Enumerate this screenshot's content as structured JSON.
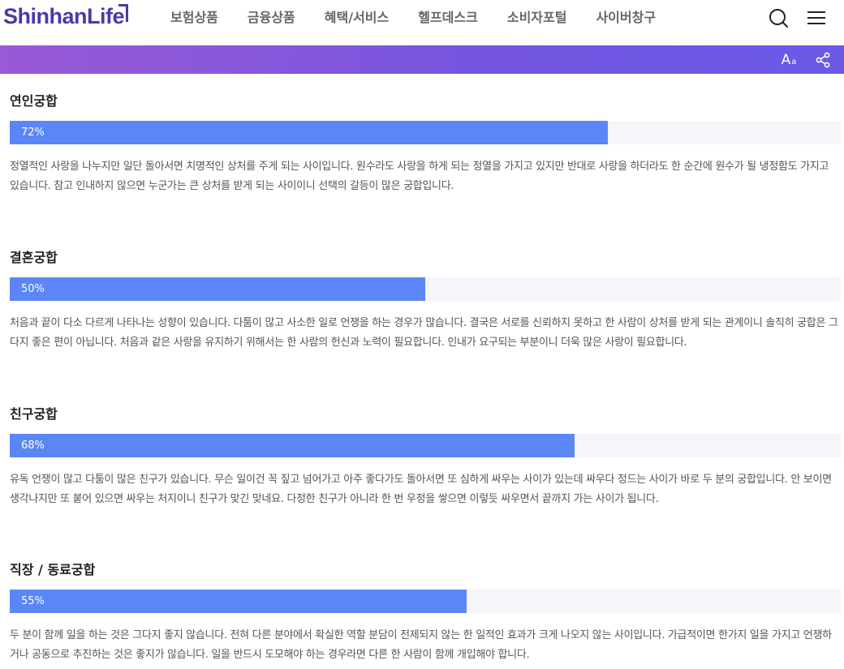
{
  "header": {
    "logo": "ShinhanLife",
    "nav": [
      "보험상품",
      "금융상품",
      "혜택/서비스",
      "헬프데스크",
      "소비자포털",
      "사이버창구"
    ],
    "icons": {
      "search": "search-icon",
      "menu": "hamburger-menu-icon"
    }
  },
  "toolbar": {
    "font_size_big": "A",
    "font_size_small": "a",
    "share_icon": "share-icon"
  },
  "colors": {
    "brand": "#4a3aa8",
    "band_start": "#9a59d6",
    "band_end": "#6a5ae6",
    "bar_fill": "#5b86f6",
    "bar_track": "#f6f6fa"
  },
  "sections": [
    {
      "title": "연인궁합",
      "percent_label": "72%",
      "percent": 72,
      "description": "정열적인 사랑을 나누지만 일단 돌아서면 치명적인 상처를 주게 되는 사이입니다. 원수라도 사랑을 하게 되는 정열을 가지고 있지만 반대로 사랑을 하더라도 한 순간에 원수가 될 냉정함도 가지고 있습니다. 참고 인내하지 않으면 누군가는 큰 상처를 받게 되는 사이이니 선택의 갈등이 많은 궁합입니다."
    },
    {
      "title": "결혼궁합",
      "percent_label": "50%",
      "percent": 50,
      "description": "처음과 끝이 다소 다르게 나타나는 성향이 있습니다. 다툼이 많고 사소한 일로 언쟁을 하는 경우가 많습니다. 결국은 서로를 신뢰하지 못하고 한 사람이 상처를 받게 되는 관계이니 솔직히 궁합은 그다지 좋은 편이 아닙니다. 처음과 같은 사랑을 유지하기 위해서는 한 사람의 헌신과 노력이 필요합니다. 인내가 요구되는 부분이니 더욱 많은 사랑이 필요합니다."
    },
    {
      "title": "친구궁합",
      "percent_label": "68%",
      "percent": 68,
      "description": "유독 언쟁이 많고 다툼이 많은 친구가 있습니다. 무슨 일이건 꼭 짚고 넘어가고 아주 좋다가도 돌아서면 또 심하게 싸우는 사이가 있는데 싸우다 정드는 사이가 바로 두 분의 궁합입니다. 안 보이면 생각나지만 또 붙어 있으면 싸우는 처지이니 친구가 맞긴 맞네요. 다정한 친구가 아니라 한 번 우정을 쌓으면 이렇듯 싸우면서 끝까지 가는 사이가 됩니다."
    },
    {
      "title": "직장 / 동료궁합",
      "percent_label": "55%",
      "percent": 55,
      "description": "두 분이 함께 일을 하는 것은 그다지 좋지 않습니다. 전혀 다른 분야에서 확실한 역할 분담이 전제되지 않는 한 일적인 효과가 크게 나오지 않는 사이입니다. 가급적이면 한가지 일을 가지고 언쟁하거나 공동으로 추진하는 것은 좋지가 않습니다. 일을 반드시 도모해야 하는 경우라면 다른 한 사람이 함께 개입해야 합니다."
    }
  ]
}
